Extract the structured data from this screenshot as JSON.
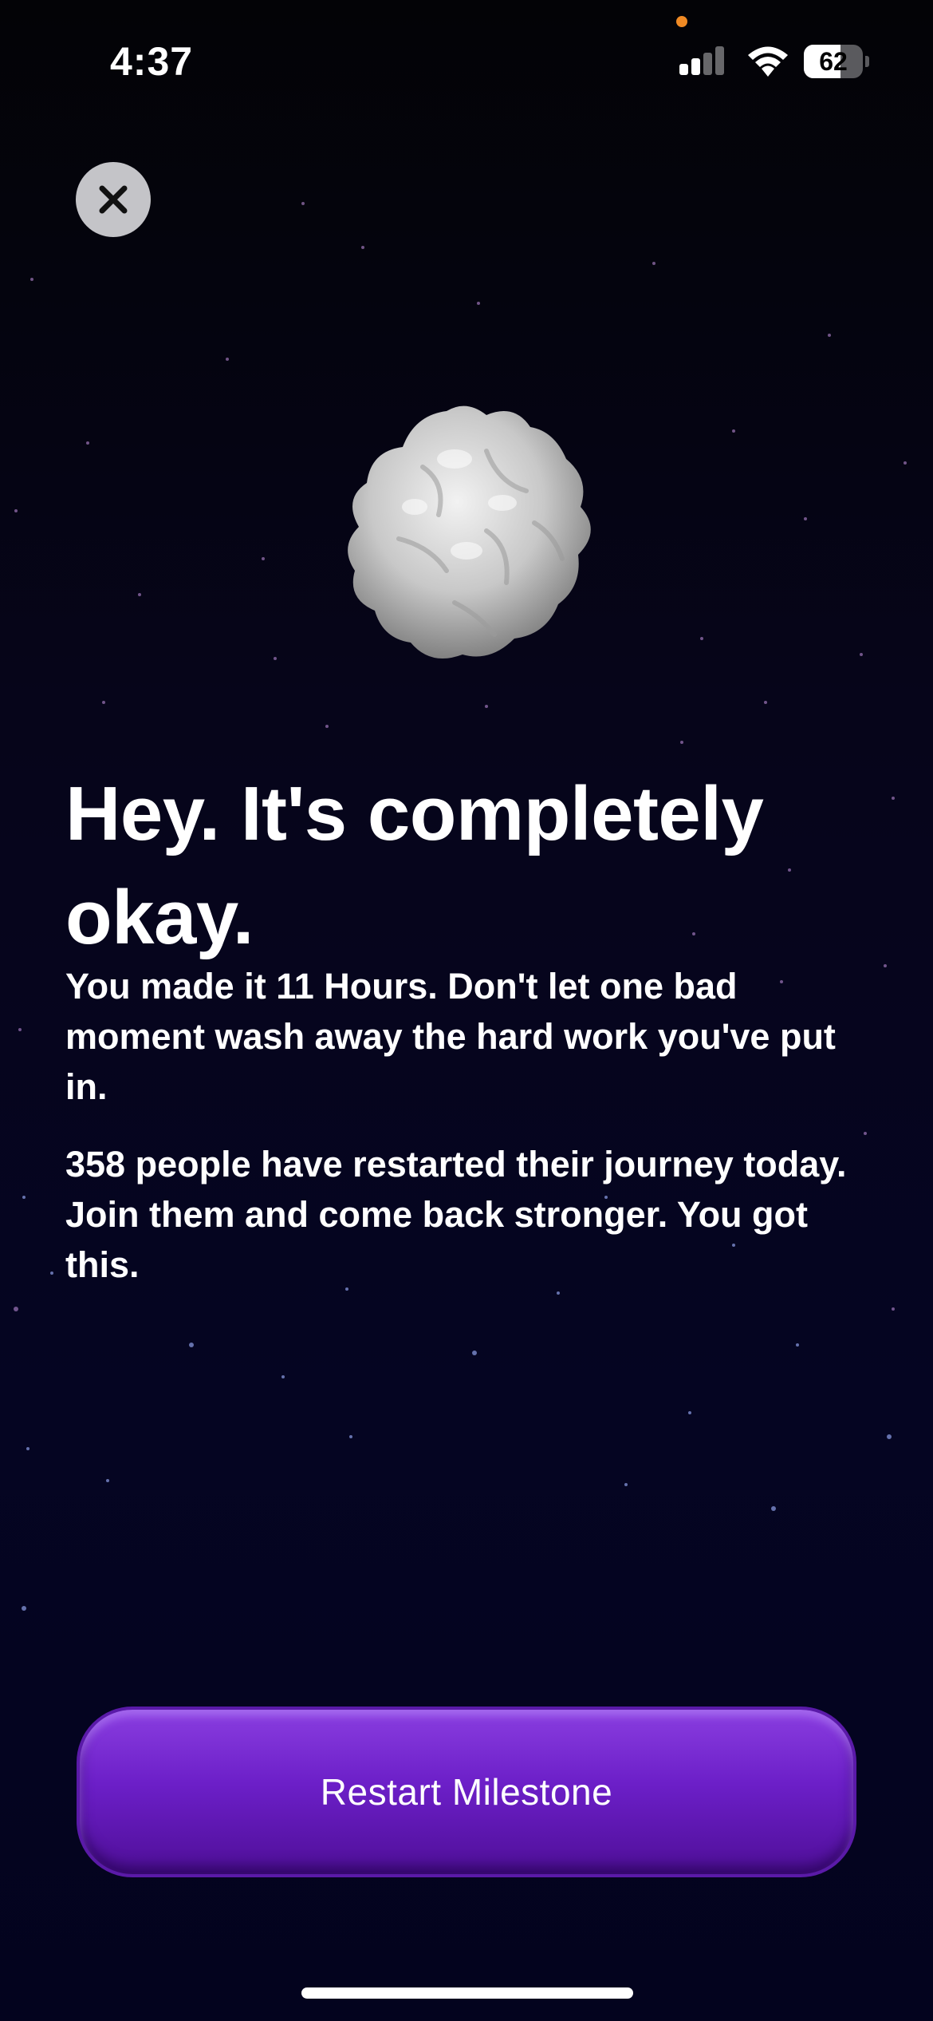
{
  "status_bar": {
    "time": "4:37",
    "battery_level": "62",
    "battery_fraction": 0.62,
    "icons": [
      "signal-icon",
      "wifi-icon",
      "battery-icon"
    ]
  },
  "close_button": {
    "icon": "close-icon"
  },
  "hero_image": {
    "icon": "rock-icon"
  },
  "content": {
    "headline": "Hey. It's completely okay.",
    "paragraph_1": "You made it 11 Hours. Don't let one bad moment wash away the hard work you've put in.",
    "paragraph_2": "358 people have restarted their journey today. Join them and come back stronger. You got this."
  },
  "actions": {
    "restart_label": "Restart Milestone"
  },
  "colors": {
    "accent": "#6c1fc8",
    "background": "#050522",
    "privacy_dot": "#f08a24"
  }
}
